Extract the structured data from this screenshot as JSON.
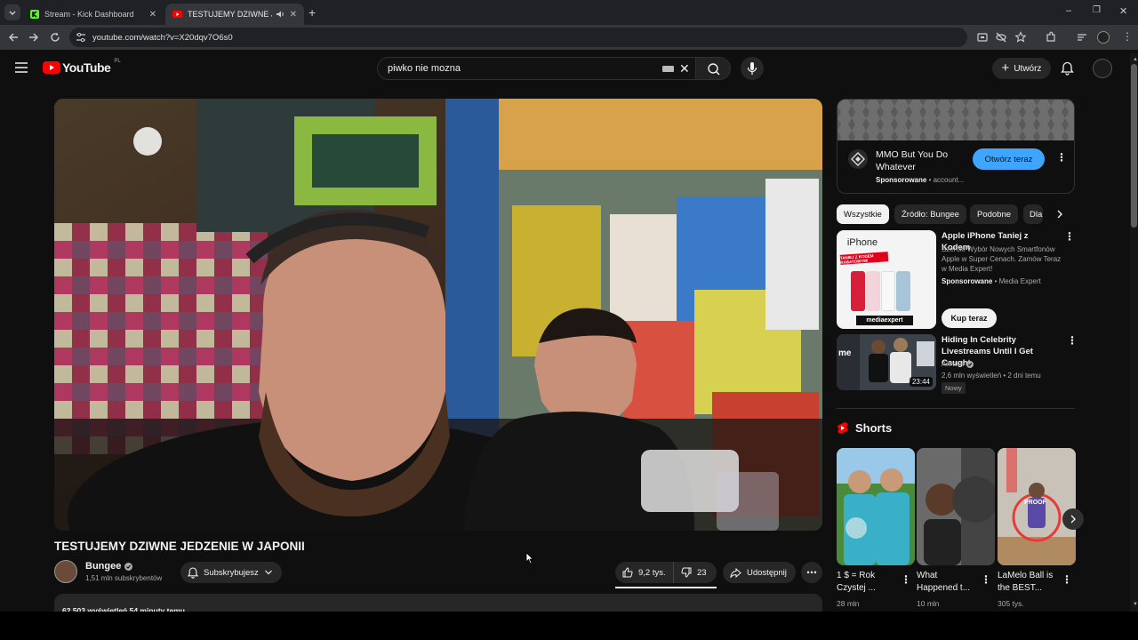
{
  "browser": {
    "tabs": [
      {
        "title": "Stream - Kick Dashboard",
        "active": false
      },
      {
        "title": "TESTUJEMY DZIWNE JEDZE",
        "active": true
      }
    ],
    "url": "youtube.com/watch?v=X20dqv7O6s0"
  },
  "header": {
    "logo_text": "YouTube",
    "region": "PL",
    "search_value": "piwko nie mozna",
    "create_label": "Utwórz"
  },
  "video": {
    "title": "TESTUJEMY DZIWNE JEDZENIE W JAPONII",
    "channel": "Bungee",
    "subscribers": "1,51 mln subskrybentów",
    "subscribe_label": "Subskrybujesz",
    "likes": "9,2 tys.",
    "dislikes": "23",
    "share_label": "Udostępnij",
    "description_peek": "62 503 wyświetleń  54 minuty temu"
  },
  "ad": {
    "title": "MMO But You Do Whatever",
    "sponsored": "Sponsorowane",
    "account": "account...",
    "cta": "Otwórz teraz"
  },
  "chips": [
    "Wszystkie",
    "Źródło: Bungee",
    "Podobne",
    "Dla"
  ],
  "recommendations": [
    {
      "title": "Apple iPhone Taniej z Kodem",
      "desc": "Szeroki Wybór Nowych Smartfonów Apple w Super Cenach. Zamów Teraz w Media Expert!",
      "sponsored": "Sponsorowane",
      "advertiser": "Media Expert",
      "cta": "Kup teraz",
      "thumb_text": "iPhone",
      "thumb_banner": "TANIEJ Z KODEM RABATOWYM!",
      "thumb_brand": "mediaexpert"
    },
    {
      "title": "Hiding In Celebrity Livestreams Until I Get Caught",
      "channel": "Airrack",
      "meta": "2,6 mln wyświetleń • 2 dni temu",
      "badge": "Nowy",
      "duration": "23:44",
      "thumb_text": "me"
    }
  ],
  "shorts": {
    "heading": "Shorts",
    "items": [
      {
        "title": "1 $ = Rok Czystej ...",
        "views": "28 mln"
      },
      {
        "title": "What Happened t...",
        "views": "10 mln"
      },
      {
        "title": "LaMelo Ball is the BEST...",
        "views": "305 tys.",
        "thumb_text": "PROOF"
      }
    ]
  },
  "colors": {
    "accent": "#ff0000",
    "chip_selected": "#f1f1f1",
    "ad_cta": "#3ea6ff",
    "kick": "#53fc18"
  }
}
